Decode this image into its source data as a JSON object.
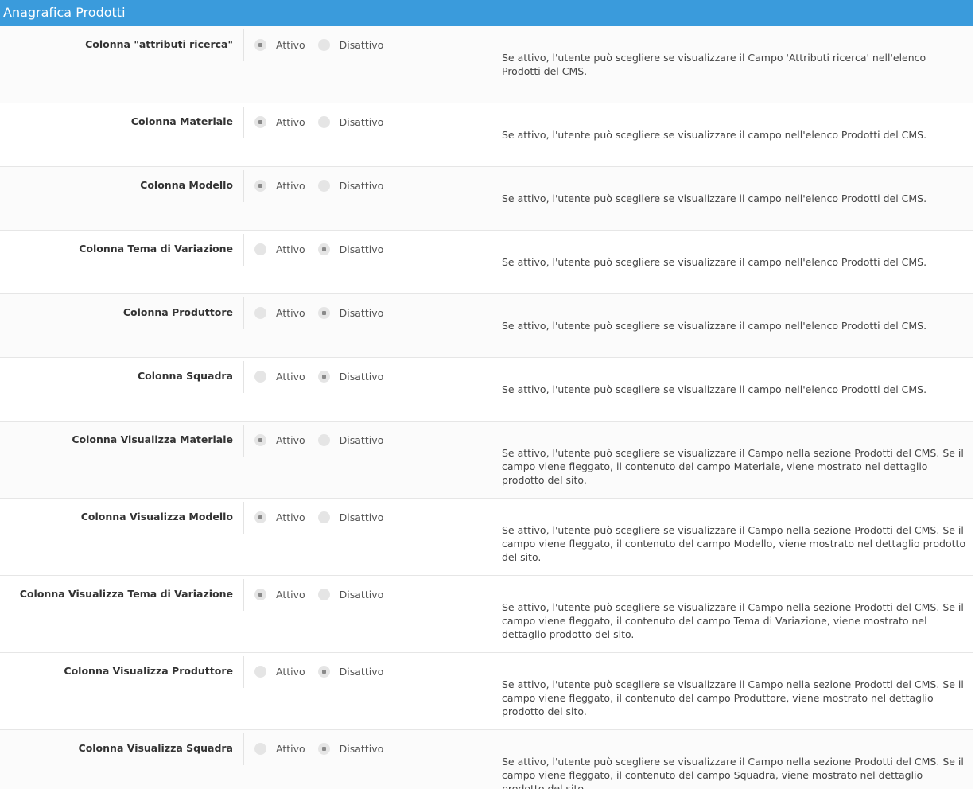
{
  "header": {
    "title": "Anagrafica Prodotti"
  },
  "options": {
    "on": "Attivo",
    "off": "Disattivo"
  },
  "rows": [
    {
      "label": "Colonna \"attributi ricerca\"",
      "selected": "Attivo",
      "description": "Se attivo, l'utente può scegliere se visualizzare il Campo 'Attributi ricerca' nell'elenco Prodotti del CMS."
    },
    {
      "label": "Colonna Materiale",
      "selected": "Attivo",
      "description": "Se attivo, l'utente può scegliere se visualizzare il campo nell'elenco Prodotti del CMS."
    },
    {
      "label": "Colonna Modello",
      "selected": "Attivo",
      "description": "Se attivo, l'utente può scegliere se visualizzare il campo nell'elenco Prodotti del CMS."
    },
    {
      "label": "Colonna Tema di Variazione",
      "selected": "Disattivo",
      "description": "Se attivo, l'utente può scegliere se visualizzare il campo nell'elenco Prodotti del CMS."
    },
    {
      "label": "Colonna Produttore",
      "selected": "Disattivo",
      "description": "Se attivo, l'utente può scegliere se visualizzare il campo nell'elenco Prodotti del CMS."
    },
    {
      "label": "Colonna Squadra",
      "selected": "Disattivo",
      "description": "Se attivo, l'utente può scegliere se visualizzare il campo nell'elenco Prodotti del CMS."
    },
    {
      "label": "Colonna Visualizza Materiale",
      "selected": "Attivo",
      "description": "Se attivo, l'utente può scegliere se visualizzare il Campo nella sezione Prodotti del CMS. Se il campo viene fleggato, il contenuto del campo Materiale, viene mostrato nel dettaglio prodotto del sito."
    },
    {
      "label": "Colonna Visualizza Modello",
      "selected": "Attivo",
      "description": "Se attivo, l'utente può scegliere se visualizzare il Campo nella sezione Prodotti del CMS. Se il campo viene fleggato, il contenuto del campo Modello, viene mostrato nel dettaglio prodotto del sito."
    },
    {
      "label": "Colonna Visualizza Tema di Variazione",
      "selected": "Attivo",
      "description": "Se attivo, l'utente può scegliere se visualizzare il Campo nella sezione Prodotti del CMS. Se il campo viene fleggato, il contenuto del campo Tema di Variazione, viene mostrato nel dettaglio prodotto del sito."
    },
    {
      "label": "Colonna Visualizza Produttore",
      "selected": "Disattivo",
      "description": "Se attivo, l'utente può scegliere se visualizzare il Campo nella sezione Prodotti del CMS. Se il campo viene fleggato, il contenuto del campo Produttore, viene mostrato nel dettaglio prodotto del sito."
    },
    {
      "label": "Colonna Visualizza Squadra",
      "selected": "Disattivo",
      "description": "Se attivo, l'utente può scegliere se visualizzare il Campo nella sezione Prodotti del CMS. Se il campo viene fleggato, il contenuto del campo Squadra, viene mostrato nel dettaglio prodotto del sito."
    }
  ],
  "colors": {
    "header_bg": "#3a9bdc",
    "row_alt_bg": "#fbfbfb",
    "radio_bg": "#e5e5e5",
    "radio_dot": "#8a8a8a"
  }
}
